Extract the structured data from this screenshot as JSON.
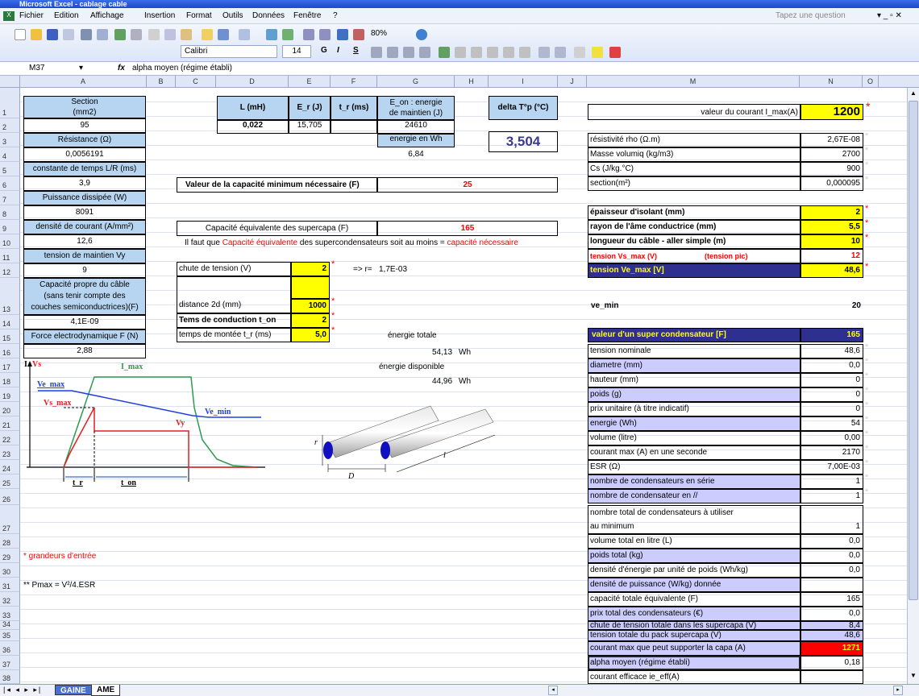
{
  "app": {
    "title": "Microsoft Excel - cablage cable",
    "search_placeholder": "Tapez une question"
  },
  "menu": [
    "Fichier",
    "Edition",
    "Affichage",
    "Insertion",
    "Format",
    "Outils",
    "Données",
    "Fenêtre",
    "?"
  ],
  "toolbar": {
    "zoom": "80%",
    "font": "Calibri",
    "size": "14",
    "bold": "G",
    "italic": "I",
    "underline": "S"
  },
  "formula": {
    "cellref": "M37",
    "fx": "fx",
    "content": "alpha moyen (régime établi)"
  },
  "columns": [
    "A",
    "B",
    "C",
    "D",
    "E",
    "F",
    "G",
    "H",
    "I",
    "J",
    "M",
    "N",
    "O"
  ],
  "rows": [
    "1",
    "2",
    "3",
    "4",
    "5",
    "6",
    "7",
    "8",
    "9",
    "10",
    "11",
    "12",
    "13",
    "14",
    "15",
    "16",
    "17",
    "18",
    "19",
    "20",
    "21",
    "22",
    "23",
    "24",
    "25",
    "26",
    "27",
    "28",
    "29",
    "30",
    "31",
    "32",
    "33",
    "34",
    "35",
    "36",
    "37",
    "38"
  ],
  "colA": {
    "r1": "Section\n(mm2)",
    "r2": "95",
    "r3": "Résistance (Ω)",
    "r4": "0,0056191",
    "r5": "constante de temps L/R (ms)",
    "r6": "3,9",
    "r7": "Puissance dissipée (W)",
    "r8": "8091",
    "r9": "densité de courant (A/mm²)",
    "r10": "12,6",
    "r11": "tension de maintien Vy",
    "r12": "9",
    "r13": "Capacité propre du câble\n(sans tenir compte des\ncouches semiconductrices)(F)",
    "r14": "4,1E-09",
    "r15": "Force electrodynamique F (N)",
    "r16": "2,88"
  },
  "top": {
    "L_h": "L (mH)",
    "Er_h": "E_r (J)",
    "tr_h": "t_r (ms)",
    "Eon_h": "E_on : energie\nde maintien (J)",
    "L": "0,022",
    "Er": "15,705",
    "tr": "",
    "Eon": "24610",
    "ewh_label": "energie en Wh",
    "ewh": "6,84",
    "dT_h": "delta T°p (°C)",
    "dT": "3,504"
  },
  "cap": {
    "min_label": "Valeur de la capacité minimum nécessaire (F)",
    "min": "25",
    "eq_label": "Capacité équivalente des supercapa (F)",
    "eq": "165",
    "note_a": "Il faut que ",
    "note_b": "Capacité équivalente",
    "note_c": " des supercondensateurs soit au moins = ",
    "note_d": "capacité nécessaire"
  },
  "inputs": {
    "chute_label": "chute de tension (V)",
    "chute": "2",
    "r_label": "=> r=",
    "r": "1,7E-03",
    "dist_label": "distance 2d (mm)",
    "dist": "1000",
    "ton_label": "Tems de conduction t_on",
    "ton": "2",
    "tr_label": "temps de montée t_r (ms)",
    "tr": "5,0"
  },
  "energy": {
    "tot_label": "énergie totale",
    "tot": "54,13",
    "tot_u": "Wh",
    "disp_label": "énergie disponible",
    "disp": "44,96",
    "disp_u": "Wh"
  },
  "notes": {
    "entree": "* grandeurs d'entrée",
    "pmax": "** Pmax = V²/4.ESR"
  },
  "right": {
    "imax_label": "valeur du courant I_max(A)",
    "imax": "1200",
    "rho_label": "résistivité rho (Ω.m)",
    "rho": "2,67E-08",
    "masse_label": "Masse volumiq (kg/m3)",
    "masse": "2700",
    "cs_label": "Cs (J/kg.°C)",
    "cs": "900",
    "sect_label": "section(m²)",
    "sect": "0,000095",
    "epais_label": "épaisseur d'isolant (mm)",
    "epais": "2",
    "rayon_label": "rayon de l'âme conductrice (mm)",
    "rayon": "5,5",
    "long_label": "longueur du câble - aller simple (m)",
    "long": "10",
    "vsmax_label": "tension Vs_max (V)",
    "vsmax_note": "(tension pic)",
    "vsmax": "12",
    "vemax_label": "tension  Ve_max [V]",
    "vemax": "48,6",
    "vemin_label": "ve_min",
    "vemin": "20",
    "sc_label": "valeur d'un super condensateur  [F]",
    "sc": "165",
    "list": [
      [
        "tension nominale",
        "48,6"
      ],
      [
        "diametre (mm)",
        "0,0"
      ],
      [
        "hauteur (mm)",
        "0"
      ],
      [
        "poids (g)",
        "0"
      ],
      [
        "prix unitaire (à titre indicatif)",
        "0"
      ],
      [
        "energie (Wh)",
        "54"
      ],
      [
        "volume (litre)",
        "0,00"
      ],
      [
        "courant max (A) en une seconde",
        "2170"
      ],
      [
        "ESR (Ω)",
        "7,00E-03"
      ],
      [
        "nombre de condensateurs en série",
        "1"
      ],
      [
        "nombre de condensateur en //",
        "1"
      ]
    ],
    "total_label_a": "nombre total de condensateurs à utiliser",
    "total_label_b": "au minimum",
    "total": "1",
    "list2": [
      [
        "volume total en litre (L)",
        "0,0"
      ],
      [
        "poids total (kg)",
        "0,0"
      ],
      [
        "densité d'énergie par unité de poids (Wh/kg)",
        "0,0"
      ],
      [
        "densité de puissance (W/kg) donnée",
        ""
      ],
      [
        "capacité totale équivalente (F)",
        "165"
      ],
      [
        "prix total des condensateurs (€)",
        "0,0"
      ]
    ],
    "chute_label": "chute de tension totale dans les supercapa  (V)",
    "chute": "8,4",
    "tpack_label": "tension totale du pack supercapa  (V)",
    "tpack": "48,6",
    "cmax_label": "courant max que peut supporter la capa (A)",
    "cmax": "1271",
    "alpha_label": "alpha moyen (régime établi)",
    "alpha": "0,18",
    "ieff_label": "courant efficace ie_eff(A)"
  },
  "diagram": {
    "I": "I",
    "Vs": "Vs",
    "Imax": "I_max",
    "Vemax": "Ve_max",
    "Vsmax": "Vs_max",
    "Vemin": "Ve_min",
    "Vy": "Vy",
    "tr": "t_r",
    "ton": "t_on",
    "r": "r",
    "D": "D",
    "l": "l"
  },
  "sheets": [
    "GAINE",
    "AME"
  ]
}
